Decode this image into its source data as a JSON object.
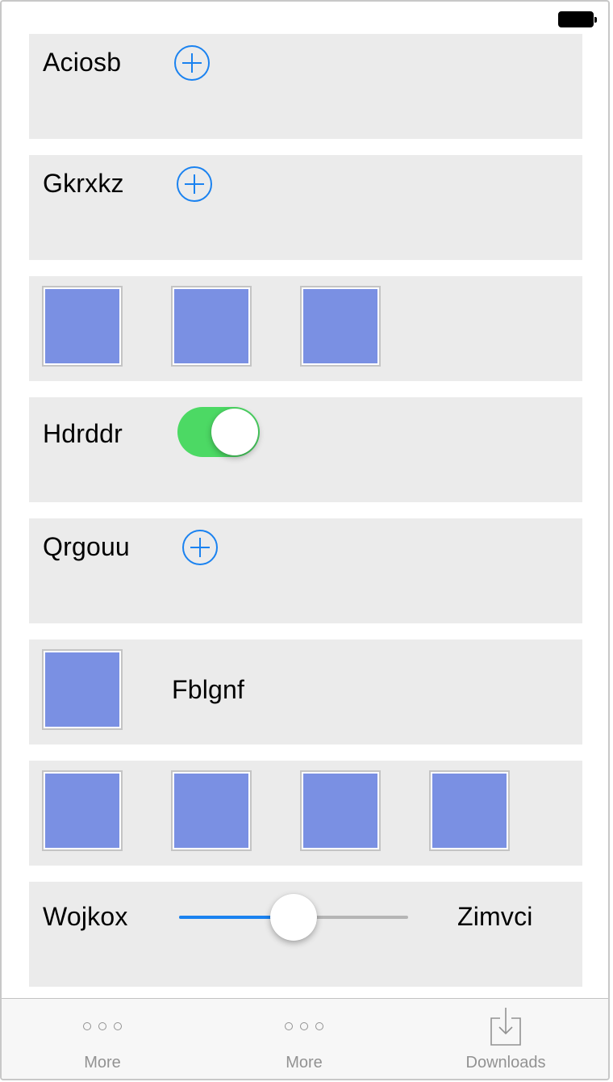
{
  "status_bar": {
    "battery_icon": "battery-full-icon"
  },
  "rows": [
    {
      "type": "label-plus",
      "label": "Aciosb",
      "icon": "plus-circle-icon",
      "accent": "#1a82f0"
    },
    {
      "type": "label-plus",
      "label": "Gkrxkz",
      "icon": "plus-circle-icon",
      "accent": "#1a82f0"
    },
    {
      "type": "thumbnails",
      "count": 3,
      "color": "#7a90e3"
    },
    {
      "type": "toggle",
      "label": "Hdrddr",
      "on": true,
      "color": "#4cd964"
    },
    {
      "type": "label-plus",
      "label": "Qrgouu",
      "icon": "plus-circle-icon",
      "accent": "#1a82f0"
    },
    {
      "type": "thumbnail-label",
      "label": "Fblgnf",
      "color": "#7a90e3"
    },
    {
      "type": "thumbnails",
      "count": 4,
      "color": "#7a90e3"
    },
    {
      "type": "slider",
      "left_label": "Wojkox",
      "right_label": "Zimvci",
      "value": 0.5,
      "color": "#1a82f0"
    }
  ],
  "tab_bar": {
    "tabs": [
      {
        "label": "More",
        "icon": "more-dots-icon"
      },
      {
        "label": "More",
        "icon": "more-dots-icon"
      },
      {
        "label": "Downloads",
        "icon": "download-tray-icon"
      }
    ]
  }
}
